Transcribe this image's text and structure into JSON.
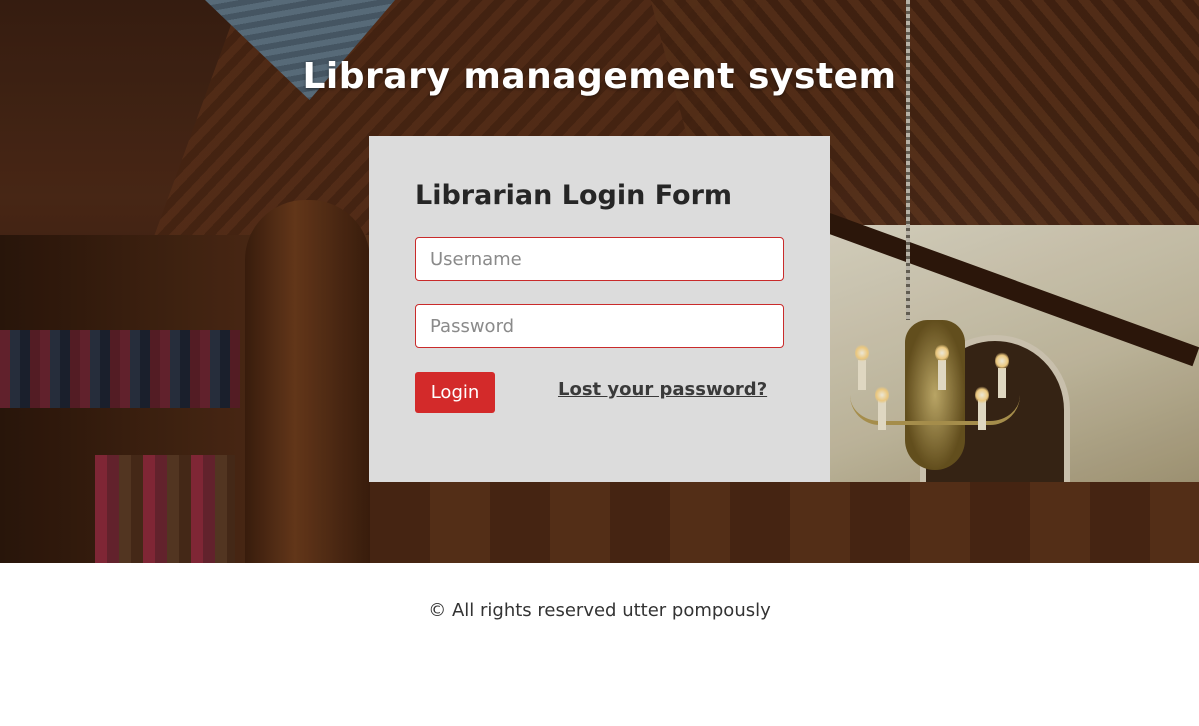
{
  "site": {
    "title": "Library management system"
  },
  "login_form": {
    "title": "Librarian Login Form",
    "username_placeholder": "Username",
    "username_value": "",
    "password_placeholder": "Password",
    "password_value": "",
    "login_label": "Login",
    "lost_password_label": "Lost your password?"
  },
  "footer": {
    "copyright": "© All rights reserved utter pompously"
  },
  "colors": {
    "accent": "#d32a2a",
    "card_background": "#dcdcdc",
    "field_border": "#c92b2b"
  }
}
